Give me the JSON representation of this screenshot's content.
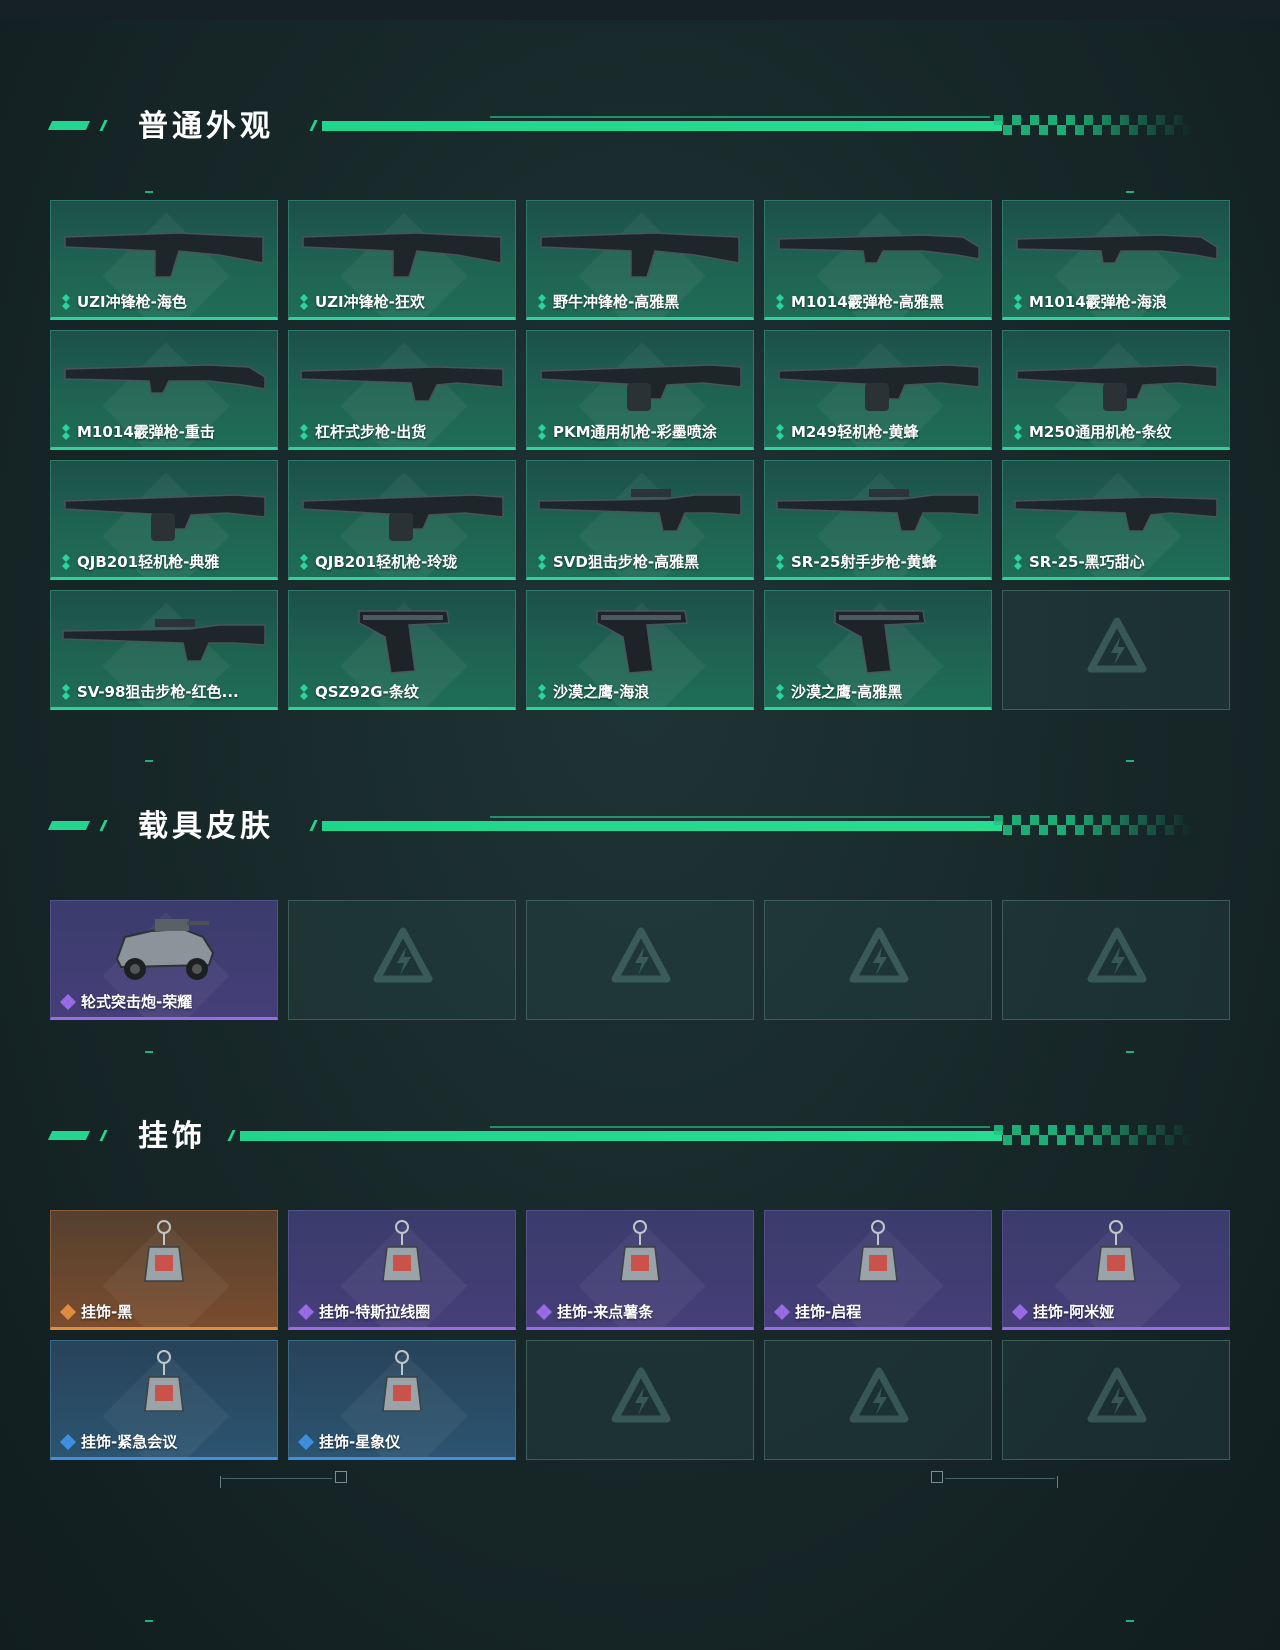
{
  "colors": {
    "accent": "#23d68f",
    "green_rarity": "#2ad49a",
    "purple_rarity": "#9a6be6",
    "orange_rarity": "#e38b3f",
    "blue_rarity": "#3f8fe0"
  },
  "sections": [
    {
      "title": "普通外观",
      "items": [
        {
          "name": "UZI冲锋枪-海色",
          "rarity": "green",
          "icon": "smg-icon"
        },
        {
          "name": "UZI冲锋枪-狂欢",
          "rarity": "green",
          "icon": "smg-icon"
        },
        {
          "name": "野牛冲锋枪-高雅黑",
          "rarity": "green",
          "icon": "smg-icon"
        },
        {
          "name": "M1014霰弹枪-高雅黑",
          "rarity": "green",
          "icon": "shotgun-icon"
        },
        {
          "name": "M1014霰弹枪-海浪",
          "rarity": "green",
          "icon": "shotgun-icon"
        },
        {
          "name": "M1014霰弹枪-重击",
          "rarity": "green",
          "icon": "shotgun-icon"
        },
        {
          "name": "杠杆式步枪-出货",
          "rarity": "green",
          "icon": "rifle-icon"
        },
        {
          "name": "PKM通用机枪-彩墨喷涂",
          "rarity": "green",
          "icon": "machine-gun-icon"
        },
        {
          "name": "M249轻机枪-黄蜂",
          "rarity": "green",
          "icon": "machine-gun-icon"
        },
        {
          "name": "M250通用机枪-条纹",
          "rarity": "green",
          "icon": "machine-gun-icon"
        },
        {
          "name": "QJB201轻机枪-典雅",
          "rarity": "green",
          "icon": "machine-gun-icon"
        },
        {
          "name": "QJB201轻机枪-玲珑",
          "rarity": "green",
          "icon": "machine-gun-icon"
        },
        {
          "name": "SVD狙击步枪-高雅黑",
          "rarity": "green",
          "icon": "sniper-icon"
        },
        {
          "name": "SR-25射手步枪-黄蜂",
          "rarity": "green",
          "icon": "sniper-icon"
        },
        {
          "name": "SR-25-黑巧甜心",
          "rarity": "green",
          "icon": "rifle-icon"
        },
        {
          "name": "SV-98狙击步枪-红色...",
          "rarity": "green",
          "icon": "sniper-icon"
        },
        {
          "name": "QSZ92G-条纹",
          "rarity": "green",
          "icon": "pistol-icon"
        },
        {
          "name": "沙漠之鹰-海浪",
          "rarity": "green",
          "icon": "pistol-icon"
        },
        {
          "name": "沙漠之鹰-高雅黑",
          "rarity": "green",
          "icon": "pistol-icon"
        }
      ]
    },
    {
      "title": "载具皮肤",
      "items": [
        {
          "name": "轮式突击炮-荣耀",
          "rarity": "purple",
          "icon": "vehicle-icon"
        }
      ]
    },
    {
      "title": "挂饰",
      "items": [
        {
          "name": "挂饰-黑",
          "rarity": "orange",
          "icon": "charm-icon"
        },
        {
          "name": "挂饰-特斯拉线圈",
          "rarity": "purple",
          "icon": "charm-icon"
        },
        {
          "name": "挂饰-来点薯条",
          "rarity": "purple",
          "icon": "charm-icon"
        },
        {
          "name": "挂饰-启程",
          "rarity": "purple",
          "icon": "charm-icon"
        },
        {
          "name": "挂饰-阿米娅",
          "rarity": "purple",
          "icon": "charm-icon"
        },
        {
          "name": "挂饰-紧急会议",
          "rarity": "blue",
          "icon": "charm-icon"
        },
        {
          "name": "挂饰-星象仪",
          "rarity": "blue",
          "icon": "charm-icon"
        }
      ]
    }
  ]
}
